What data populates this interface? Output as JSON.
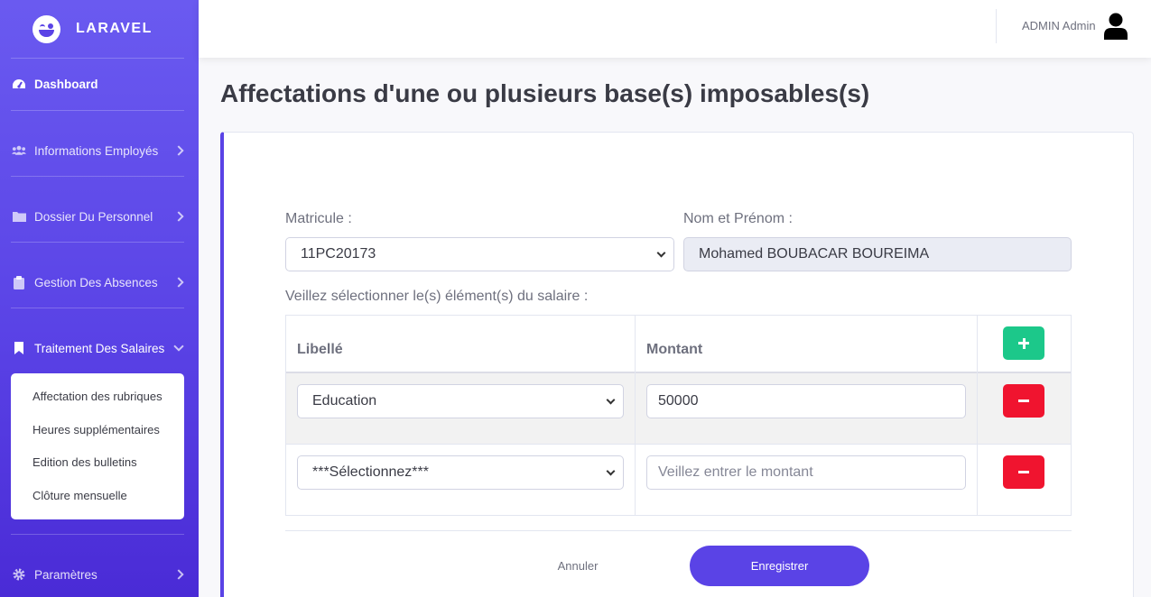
{
  "brand": {
    "name": "LARAVEL"
  },
  "sidebar": {
    "items": [
      {
        "label": "Dashboard",
        "icon": "tachometer-icon"
      },
      {
        "label": "Informations Employés",
        "icon": "users-icon"
      },
      {
        "label": "Dossier Du Personnel",
        "icon": "folder-icon"
      },
      {
        "label": "Gestion Des Absences",
        "icon": "clipboard-icon"
      },
      {
        "label": "Traitement Des Salaires",
        "icon": "bookmark-icon"
      },
      {
        "label": "Paramètres",
        "icon": "gear-icon"
      }
    ],
    "submenu": [
      "Affectation des rubriques",
      "Heures supplémentaires",
      "Edition des bulletins",
      "Clôture mensuelle"
    ]
  },
  "topbar": {
    "user_name": "ADMIN Admin"
  },
  "page": {
    "title": "Affectations d'une ou plusieurs base(s) imposables(s)"
  },
  "form": {
    "matricule_label": "Matricule :",
    "matricule_value": "11PC20173",
    "nom_label": "Nom et Prénom :",
    "nom_value": "Mohamed BOUBACAR BOUREIMA",
    "instruction": "Veillez sélectionner le(s) élément(s) du salaire :",
    "table": {
      "col_libelle": "Libellé",
      "col_montant": "Montant",
      "rows": [
        {
          "libelle": "Education",
          "montant": "50000",
          "montant_placeholder": "Veillez entrer le montant"
        },
        {
          "libelle": "***Sélectionnez***",
          "montant": "",
          "montant_placeholder": "Veillez entrer le montant"
        }
      ]
    },
    "cancel_label": "Annuler",
    "save_label": "Enregistrer"
  },
  "colors": {
    "accent": "#5a43e6",
    "add": "#1cc88a",
    "remove": "#f0142f"
  }
}
